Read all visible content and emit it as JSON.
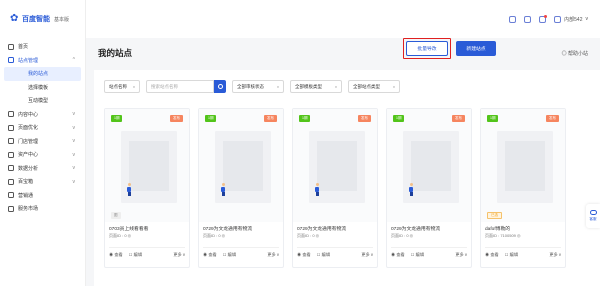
{
  "logo": {
    "brand": "百度智能",
    "edition": "基本版"
  },
  "sidebar": {
    "items": [
      {
        "label": "首页",
        "icon": "home-icon"
      },
      {
        "label": "站点管理",
        "icon": "site-icon",
        "arrow": "^"
      },
      {
        "label": "我的站点",
        "sub": true,
        "active": true
      },
      {
        "label": "选择模板",
        "sub": true
      },
      {
        "label": "互动模型",
        "sub": true
      },
      {
        "label": "内容中心",
        "icon": "content-icon",
        "arrow": "v"
      },
      {
        "label": "页面优化",
        "icon": "optimize-icon",
        "arrow": "v"
      },
      {
        "label": "门店管理",
        "icon": "store-icon",
        "arrow": "v"
      },
      {
        "label": "资产中心",
        "icon": "asset-icon",
        "arrow": "v"
      },
      {
        "label": "数据分析",
        "icon": "analytics-icon",
        "arrow": "v"
      },
      {
        "label": "百宝箱",
        "icon": "toolbox-icon",
        "arrow": "v"
      },
      {
        "label": "营销通",
        "icon": "marketing-icon"
      },
      {
        "label": "服务市场",
        "icon": "market-icon"
      }
    ]
  },
  "topbar": {
    "user": "内部542",
    "caret": "v"
  },
  "page": {
    "title": "我的站点",
    "help": "帮助小站"
  },
  "filters": {
    "name_select": "站点名称",
    "search_placeholder": "搜索站点名称",
    "review_status": "全部审核状态",
    "template_type": "全部模板类型",
    "site_type": "全部站点类型"
  },
  "buttons": {
    "batch": "批量导改",
    "new": "新建站点"
  },
  "cards": [
    {
      "tag_left": "1期",
      "tag_right": "发布",
      "badge": "图",
      "badge_style": "grey",
      "title": "0703员上线看看看",
      "sub": "页面ID : 0 ◎",
      "view": "查看",
      "edit": "编辑",
      "more": "更多"
    },
    {
      "tag_left": "1期",
      "tag_right": "发布",
      "badge": "",
      "badge_style": "",
      "title": "0729为文龙通用有物流",
      "sub": "页面ID : 0 ◎",
      "view": "查看",
      "edit": "编辑",
      "more": "更多"
    },
    {
      "tag_left": "1期",
      "tag_right": "发布",
      "badge": "",
      "badge_style": "",
      "title": "0729为文龙通用有物流",
      "sub": "页面ID : 0 ◎",
      "view": "查看",
      "edit": "编辑",
      "more": "更多"
    },
    {
      "tag_left": "1期",
      "tag_right": "发布",
      "badge": "",
      "badge_style": "",
      "title": "0729为文龙通用有物流",
      "sub": "页面ID : 0 ◎",
      "view": "查看",
      "edit": "编辑",
      "more": "更多"
    },
    {
      "tag_left": "1期",
      "tag_right": "发布",
      "badge": "已选",
      "badge_style": "orange",
      "title": "dafof博勒的",
      "sub": "页面ID : 7100509 ◎",
      "view": "查看",
      "edit": "编辑",
      "more": "更多"
    }
  ],
  "float_widget": {
    "label": "客服"
  },
  "colors": {
    "accent": "#2a5bd7",
    "highlight": "#e02020",
    "tag_green": "#52c41a",
    "tag_orange": "#f6855f"
  }
}
